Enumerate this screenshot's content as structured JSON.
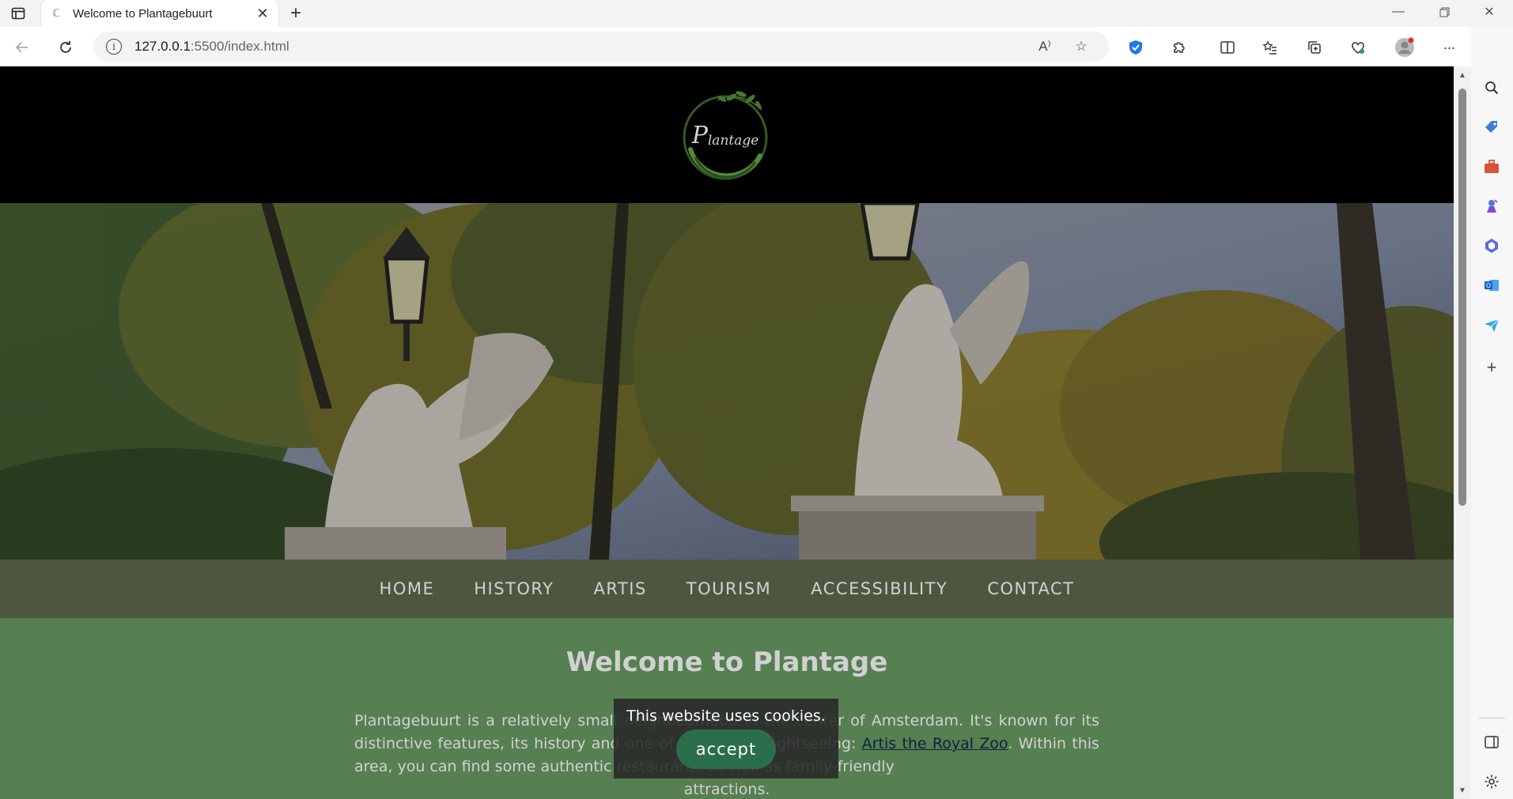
{
  "browser": {
    "tab_title": "Welcome to Plantagebuurt",
    "url_host": "127.0.0.1",
    "url_rest": ":5500/index.html",
    "read_aloud_glyph": "A⁾",
    "more_glyph": "···"
  },
  "site": {
    "logo_text": "Plantage",
    "nav": [
      "HOME",
      "HISTORY",
      "ARTIS",
      "TOURISM",
      "ACCESSIBILITY",
      "CONTACT"
    ],
    "welcome_title": "Welcome to Plantage",
    "intro_before_link": "Plantagebuurt is a relatively small neighbourhood in the center of Amsterdam. It's known for its distinctive features, its history and one of its famous sightseeing: ",
    "intro_link": "Artis the Royal Zoo",
    "intro_after_link": ". Within this area, you can find some authentic restaurants as well as family-friendly",
    "intro_last": "attractions."
  },
  "cookie": {
    "message": "This website uses cookies.",
    "button": "accept"
  },
  "colors": {
    "header_bg": "#000000",
    "nav_bg": "#5f6b4f",
    "content_bg": "#6a9c64",
    "cookie_button": "#2b6e4b",
    "link": "#0f2a46"
  }
}
